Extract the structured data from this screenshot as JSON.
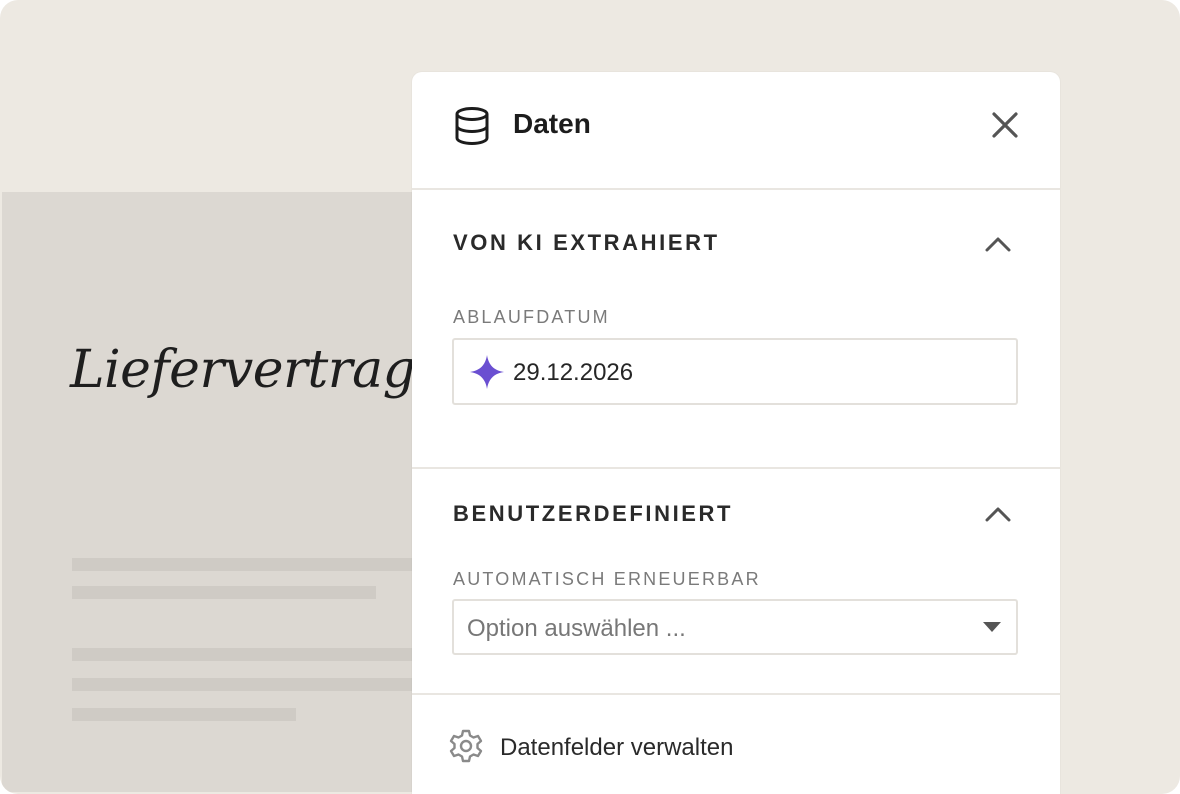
{
  "document": {
    "title": "Liefervertrag"
  },
  "panel": {
    "title": "Daten",
    "header_icon": "database-icon",
    "close_icon": "close-icon"
  },
  "sections": {
    "ai_extracted": {
      "title": "VON KI EXTRAHIERT",
      "field_label": "ABLAUFDATUM",
      "field_value": "29.12.2026",
      "field_icon": "sparkle-icon"
    },
    "custom": {
      "title": "BENUTZERDEFINIERT",
      "field_label": "AUTOMATISCH ERNEUERBAR",
      "select_placeholder": "Option auswählen ..."
    }
  },
  "footer": {
    "label": "Datenfelder verwalten",
    "icon": "gear-icon"
  },
  "colors": {
    "background": "#ede9e2",
    "document": "#dcd8d2",
    "panel": "#ffffff",
    "sparkle": "#6a4fd1",
    "text": "#1c1c1c"
  }
}
